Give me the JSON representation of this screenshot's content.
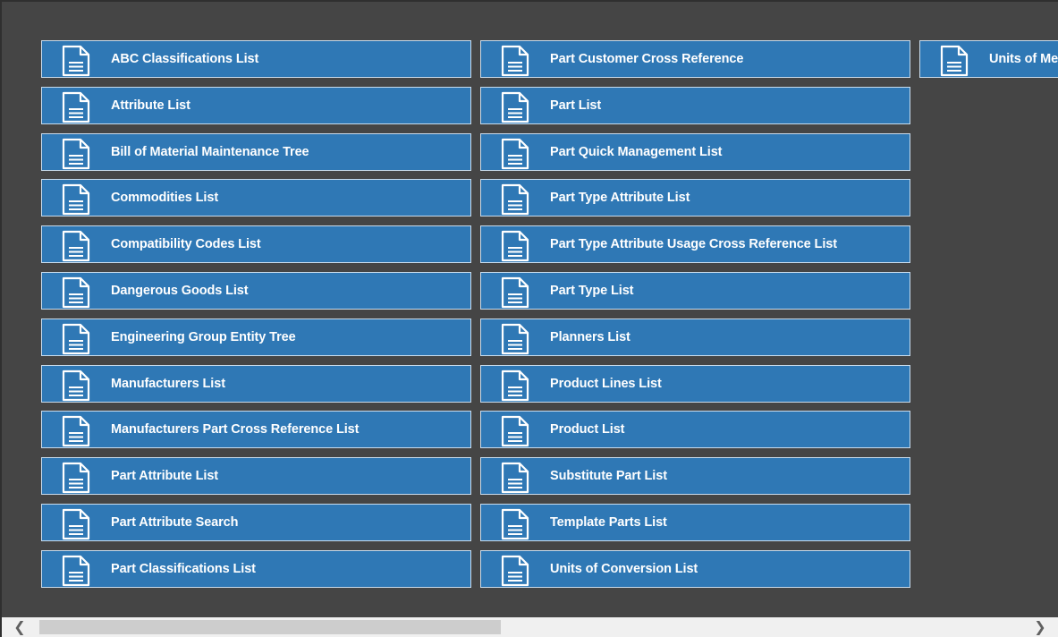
{
  "tiles": {
    "col1": [
      {
        "label": "ABC Classifications List",
        "icon": "document-icon"
      },
      {
        "label": "Attribute List",
        "icon": "document-icon"
      },
      {
        "label": "Bill of Material Maintenance Tree",
        "icon": "document-icon"
      },
      {
        "label": "Commodities List",
        "icon": "document-icon"
      },
      {
        "label": "Compatibility Codes List",
        "icon": "document-icon"
      },
      {
        "label": "Dangerous Goods List",
        "icon": "document-icon"
      },
      {
        "label": "Engineering Group Entity Tree",
        "icon": "document-icon"
      },
      {
        "label": "Manufacturers List",
        "icon": "document-icon"
      },
      {
        "label": "Manufacturers Part Cross Reference List",
        "icon": "document-icon"
      },
      {
        "label": "Part Attribute List",
        "icon": "document-icon"
      },
      {
        "label": "Part Attribute Search",
        "icon": "document-icon"
      },
      {
        "label": "Part Classifications List",
        "icon": "document-icon"
      }
    ],
    "col2": [
      {
        "label": "Part Customer Cross Reference",
        "icon": "document-icon"
      },
      {
        "label": "Part List",
        "icon": "document-icon"
      },
      {
        "label": "Part Quick Management List",
        "icon": "document-icon"
      },
      {
        "label": "Part Type Attribute List",
        "icon": "document-icon"
      },
      {
        "label": "Part Type Attribute Usage Cross Reference List",
        "icon": "document-icon"
      },
      {
        "label": "Part Type List",
        "icon": "document-icon"
      },
      {
        "label": "Planners List",
        "icon": "document-icon"
      },
      {
        "label": "Product Lines List",
        "icon": "document-icon"
      },
      {
        "label": "Product List",
        "icon": "document-icon"
      },
      {
        "label": "Substitute Part List",
        "icon": "document-icon"
      },
      {
        "label": "Template Parts List",
        "icon": "document-icon"
      },
      {
        "label": "Units of Conversion List",
        "icon": "document-icon"
      }
    ],
    "col3": [
      {
        "label": "Units of Me",
        "icon": "document-icon"
      }
    ]
  },
  "scrollbar": {
    "left_arrow": "❮",
    "right_arrow": "❯",
    "position_fraction": 0.0,
    "visible_fraction": 0.47
  },
  "colors": {
    "background": "#454545",
    "tile": "#2f78b5",
    "tile_border": "#c9dced",
    "text": "#ffffff"
  }
}
